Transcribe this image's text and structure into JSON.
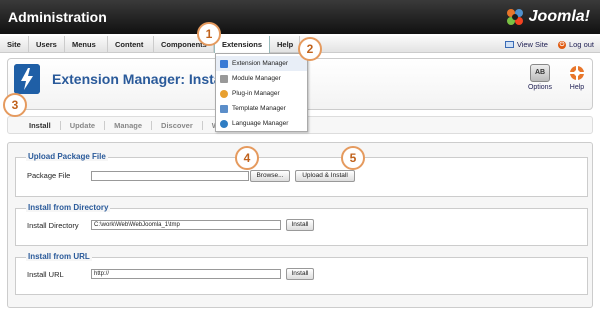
{
  "header": {
    "title": "Administration",
    "brand": "Joomla!"
  },
  "menu": {
    "items": [
      "Site",
      "Users",
      "Menus",
      "Content",
      "Components",
      "Extensions",
      "Help"
    ],
    "view_site": "View Site",
    "log_out": "Log out"
  },
  "extensions_menu": {
    "items": [
      "Extension Manager",
      "Module Manager",
      "Plug-in Manager",
      "Template Manager",
      "Language Manager"
    ]
  },
  "toolbar": {
    "title": "Extension Manager: Install",
    "options_label": "Options",
    "options_icon_text": "AB",
    "help_label": "Help"
  },
  "subtabs": [
    "Install",
    "Update",
    "Manage",
    "Discover",
    "Warnings"
  ],
  "upload": {
    "legend": "Upload Package File",
    "label": "Package File",
    "value": "",
    "browse_label": "Browse...",
    "submit_label": "Upload & Install"
  },
  "directory": {
    "legend": "Install from Directory",
    "label": "Install Directory",
    "value": "C:\\work\\Web\\WebJoomla_1\\tmp",
    "submit_label": "Install"
  },
  "url": {
    "legend": "Install from URL",
    "label": "Install URL",
    "value": "http://",
    "submit_label": "Install"
  },
  "callouts": [
    "1",
    "2",
    "3",
    "4",
    "5"
  ],
  "colors": {
    "accent": "#2a5a9a",
    "callout": "#e59a5e",
    "header_bg": "#1a1a1a"
  }
}
